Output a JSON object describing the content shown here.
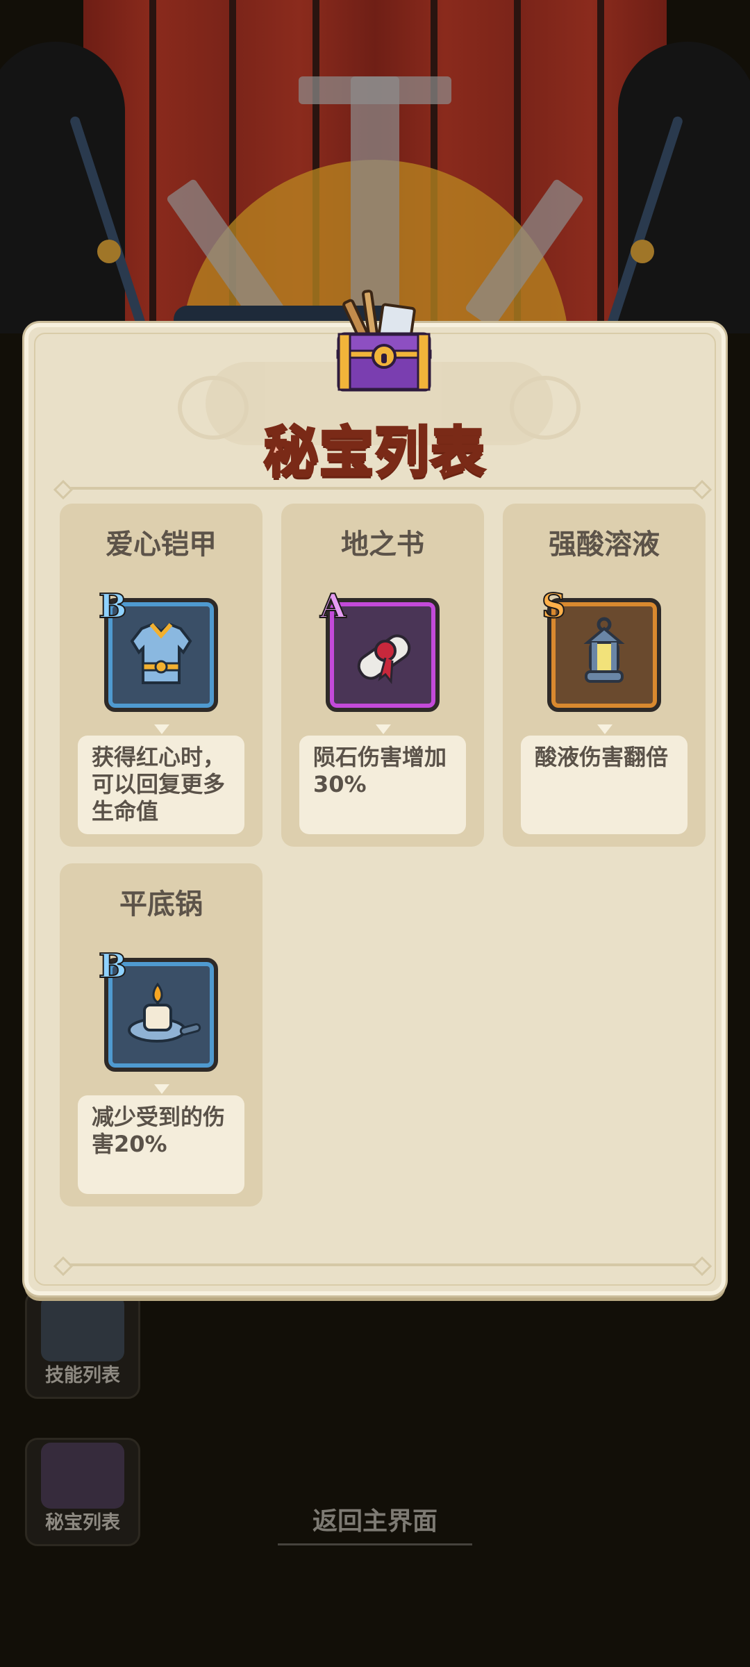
{
  "dialog": {
    "title": "秘宝列表",
    "treasures": [
      {
        "name": "爱心铠甲",
        "rank": "B",
        "description": "获得红心时，可以回复更多生命值",
        "icon": "armor-icon"
      },
      {
        "name": "地之书",
        "rank": "A",
        "description": "陨石伤害增加30%",
        "icon": "scroll-icon"
      },
      {
        "name": "强酸溶液",
        "rank": "S",
        "description": "酸液伤害翻倍",
        "icon": "lantern-icon"
      },
      {
        "name": "平底锅",
        "rank": "B",
        "description": "减少受到的伤害20%",
        "icon": "candle-pan-icon"
      }
    ]
  },
  "side_menu": {
    "skills_label": "技能列表",
    "treasure_label": "秘宝列表"
  },
  "back_button": {
    "label": "返回主界面"
  },
  "colors": {
    "rank_b": "#4f9ad0",
    "rank_a": "#c34ad9",
    "rank_s": "#d9892f",
    "title": "#f6b7a0"
  }
}
